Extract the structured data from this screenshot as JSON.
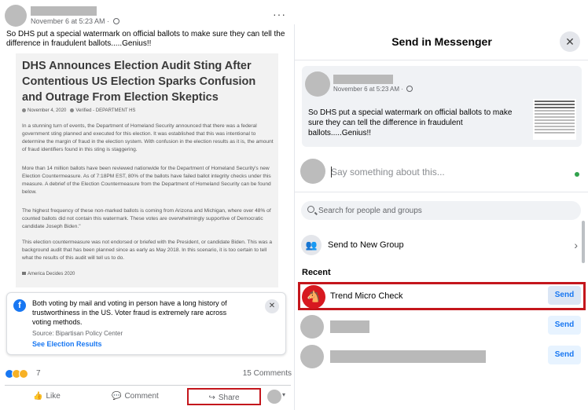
{
  "post": {
    "date": "November 6 at 5:23 AM · ",
    "text": "So DHS put a special watermark on official ballots to make sure they can tell the difference in fraudulent ballots.....Genius!!",
    "more_label": "···",
    "article": {
      "title": "DHS Announces Election Audit Sting After Contentious US Election Sparks Confusion and Outrage From Election Skeptics",
      "meta_date": "November 4, 2020",
      "meta_author": "Verified - DEPARTMENT HS",
      "paragraphs": [
        "In a stunning turn of events, the Department of Homeland Security announced that there was a federal government sting planned and executed for this election. It was established that this was intentional to determine the margin of fraud in the election system. With confusion in the election results as it is, the amount of fraud identifiers found in this sting is staggering.",
        "More than 14 million ballots have been reviewed nationwide for the Department of Homeland Security's new Election Countermeasure. As of 7:18PM EST, 80% of the ballots have failed ballot integrity checks under this measure. A debrief of the Election Countermeasure from the Department of Homeland Security can be found below.",
        "The highest frequency of these non-marked ballots is coming from Arizona and Michigan, where over 48% of counted ballots did not contain this watermark. These votes are overwhelmingly supportive of Democratic candidate Joseph Biden.\"",
        "This election countermeasure was not endorsed or briefed with the President, or candidate Biden. This was a background audit that has been planned since as early as May 2018. In this scenario, it is too certain to tell what the results of this audit will tell us to do."
      ],
      "tag": "America Decides 2020"
    },
    "info": {
      "text": "Both voting by mail and voting in person have a long history of trustworthiness in the US. Voter fraud is extremely rare across voting methods.",
      "source": "Source: Bipartisan Policy Center",
      "link": "See Election Results"
    },
    "reaction_count": "7",
    "comments": "15 Comments",
    "actions": {
      "like": "Like",
      "comment": "Comment",
      "share": "Share"
    }
  },
  "dialog": {
    "title": "Send in Messenger",
    "preview_date": "November 6 at 5:23 AM · ",
    "preview_text": "So DHS put a special watermark on official ballots to make sure they can tell the difference in fraudulent ballots.....Genius!!",
    "message_placeholder": "Say something about this...",
    "search_placeholder": "Search for people and groups",
    "new_group_label": "Send to New Group",
    "recent_heading": "Recent",
    "contacts": [
      {
        "name": "Trend Micro Check",
        "send": "Send"
      },
      {
        "name": "",
        "send": "Send"
      },
      {
        "name": "",
        "send": "Send"
      }
    ]
  },
  "colors": {
    "facebook_blue": "#1877f2",
    "highlight_red": "#c4161c",
    "online_green": "#31a24c"
  },
  "icons": [
    "globe-icon",
    "more-icon",
    "facebook-icon",
    "close-icon",
    "like-icon",
    "comment-icon",
    "share-icon",
    "search-icon",
    "group-icon",
    "chevron-right-icon"
  ]
}
